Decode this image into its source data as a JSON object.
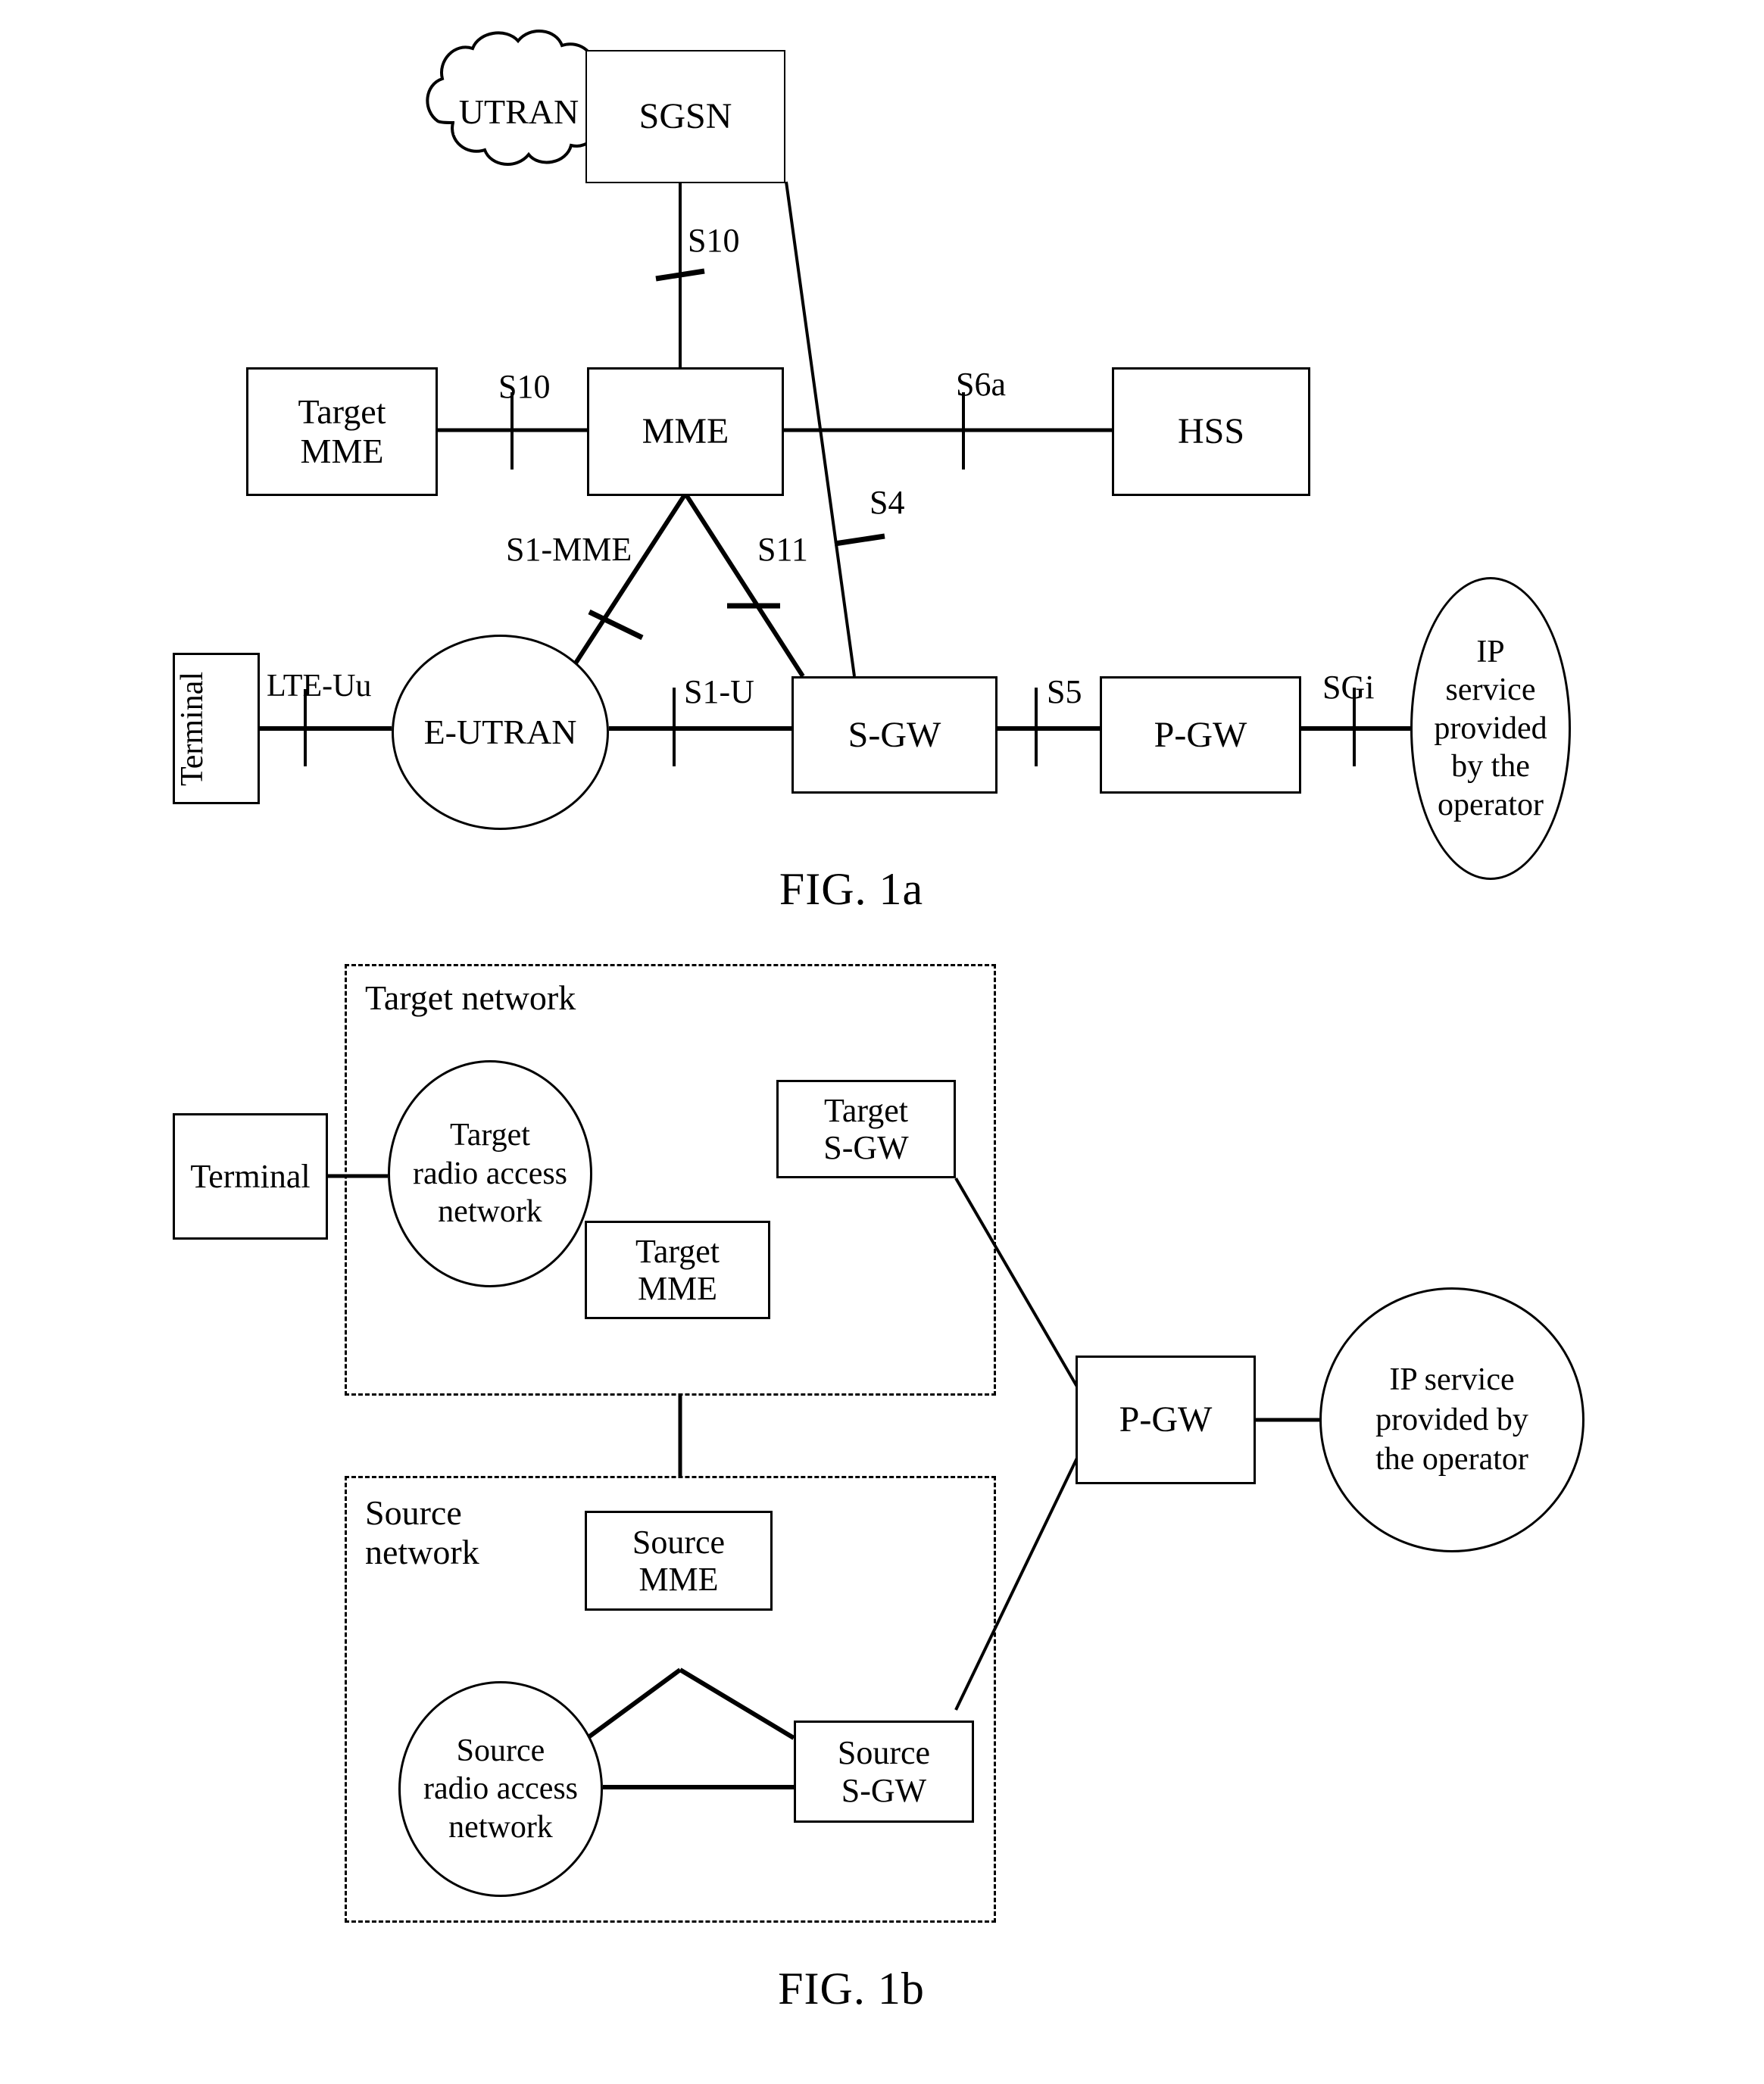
{
  "figures": [
    {
      "id": "fig1a",
      "caption": "FIG. 1a",
      "nodes": {
        "utran": "UTRAN",
        "sgsn": "SGSN",
        "target_mme": "Target\nMME",
        "mme": "MME",
        "hss": "HSS",
        "terminal": "Terminal",
        "eutran": "E-UTRAN",
        "sgw": "S-GW",
        "pgw": "P-GW",
        "ip_service": "IP\nservice\nprovided\nby the\noperator"
      },
      "interfaces": {
        "sgsn_mme": "S10",
        "target_mme_mme": "S10",
        "mme_hss": "S6a",
        "sgsn_sgw": "S4",
        "mme_eutran": "S1-MME",
        "mme_sgw": "S11",
        "terminal_eutran": "LTE-Uu",
        "eutran_sgw": "S1-U",
        "sgw_pgw": "S5",
        "pgw_ip": "SGi"
      }
    },
    {
      "id": "fig1b",
      "caption": "FIG. 1b",
      "groups": {
        "target_network": "Target network",
        "source_network": "Source\nnetwork"
      },
      "nodes": {
        "terminal": "Terminal",
        "target_ran": "Target\nradio access\nnetwork",
        "target_sgw": "Target\nS-GW",
        "target_mme": "Target\nMME",
        "source_mme": "Source\nMME",
        "source_ran": "Source\nradio access\nnetwork",
        "source_sgw": "Source\nS-GW",
        "pgw": "P-GW",
        "ip_service": "IP service\nprovided by\nthe operator"
      }
    }
  ],
  "colors": {
    "ink": "#000000",
    "paper": "#ffffff"
  }
}
